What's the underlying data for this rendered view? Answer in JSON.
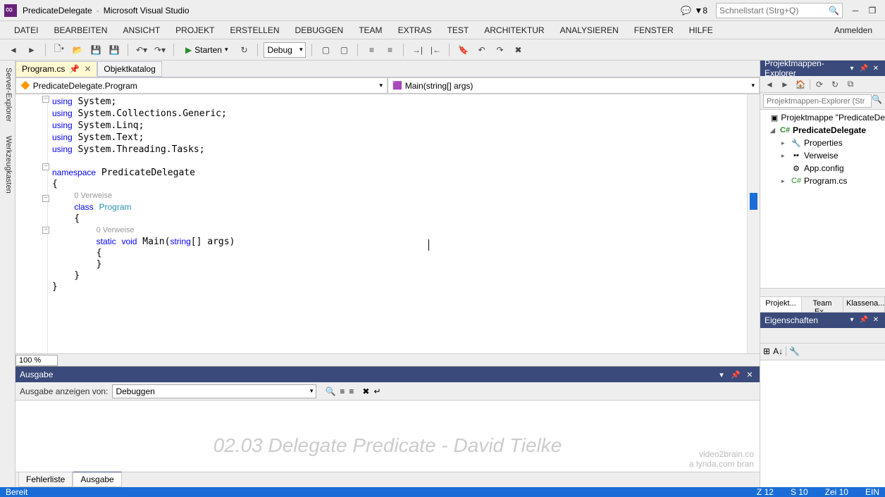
{
  "title": {
    "project": "PredicateDelegate",
    "app": "Microsoft Visual Studio"
  },
  "notifications": "8",
  "quick_search_placeholder": "Schnellstart (Strg+Q)",
  "login_label": "Anmelden",
  "menu": [
    "DATEI",
    "BEARBEITEN",
    "ANSICHT",
    "PROJEKT",
    "ERSTELLEN",
    "DEBUGGEN",
    "TEAM",
    "EXTRAS",
    "TEST",
    "ARCHITEKTUR",
    "ANALYSIEREN",
    "FENSTER",
    "HILFE"
  ],
  "toolbar": {
    "start": "Starten",
    "config": "Debug"
  },
  "side_tabs": [
    "Server-Explorer",
    "Werkzeugkasten"
  ],
  "doc_tabs": [
    {
      "label": "Program.cs",
      "active": true
    },
    {
      "label": "Objektkatalog",
      "active": false
    }
  ],
  "nav": {
    "left": "PredicateDelegate.Program",
    "right": "Main(string[] args)"
  },
  "zoom": "100 %",
  "code": {
    "usings": [
      "System",
      "System.Collections.Generic",
      "System.Linq",
      "System.Text",
      "System.Threading.Tasks"
    ],
    "namespace": "PredicateDelegate",
    "ref0": "0 Verweise",
    "class": "Program",
    "ref1": "0 Verweise",
    "method_sig": {
      "mod": "static",
      "ret": "void",
      "name": "Main",
      "param_type": "string",
      "param_rest": "[] args"
    }
  },
  "output": {
    "title": "Ausgabe",
    "show_label": "Ausgabe anzeigen von:",
    "source": "Debuggen"
  },
  "bottom_tabs": [
    "Fehlerliste",
    "Ausgabe"
  ],
  "solution_explorer": {
    "title": "Projektmappen-Explorer",
    "search_placeholder": "Projektmappen-Explorer (Str",
    "solution": "Projektmappe \"PredicateDe",
    "project": "PredicateDelegate",
    "items": [
      "Properties",
      "Verweise",
      "App.config",
      "Program.cs"
    ],
    "tabs": [
      "Projekt...",
      "Team Ex...",
      "Klassena..."
    ]
  },
  "properties": {
    "title": "Eigenschaften"
  },
  "status": {
    "ready": "Bereit",
    "z": "Z 12",
    "s": "S 10",
    "zei": "Zei 10",
    "ins": "EIN"
  },
  "watermark": "02.03 Delegate Predicate - David Tielke",
  "brand1": "video2brain.co",
  "brand2": "a lynda.com bran"
}
